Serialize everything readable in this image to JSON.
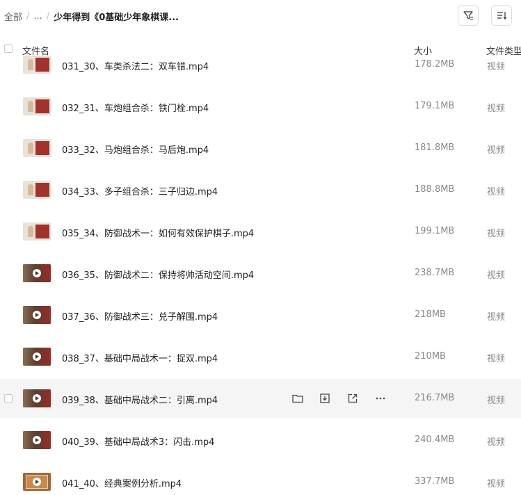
{
  "breadcrumb": {
    "root": "全部",
    "ellipsis": "...",
    "current": "少年得到《0基础少年象棋课..."
  },
  "toolbar": {
    "filter_icon": "filter-icon",
    "sort_icon": "sort-icon"
  },
  "table": {
    "headers": {
      "name": "文件名",
      "size": "大小",
      "type": "文件类型"
    },
    "rows": [
      {
        "name": "031_30、车类杀法二：双车错.mp4",
        "size": "178.2MB",
        "type": "视频",
        "thumb": "light"
      },
      {
        "name": "032_31、车炮组合杀：铁门栓.mp4",
        "size": "179.1MB",
        "type": "视频",
        "thumb": "light"
      },
      {
        "name": "033_32、马炮组合杀：马后炮.mp4",
        "size": "181.8MB",
        "type": "视频",
        "thumb": "light"
      },
      {
        "name": "034_33、多子组合杀：三子归边.mp4",
        "size": "188.8MB",
        "type": "视频",
        "thumb": "light"
      },
      {
        "name": "035_34、防御战术一：如何有效保护棋子.mp4",
        "size": "199.1MB",
        "type": "视频",
        "thumb": "light"
      },
      {
        "name": "036_35、防御战术二：保持将帅活动空间.mp4",
        "size": "238.7MB",
        "type": "视频",
        "thumb": "dark"
      },
      {
        "name": "037_36、防御战术三：兑子解围.mp4",
        "size": "218MB",
        "type": "视频",
        "thumb": "dark"
      },
      {
        "name": "038_37、基础中局战术一：捉双.mp4",
        "size": "210MB",
        "type": "视频",
        "thumb": "dark"
      },
      {
        "name": "039_38、基础中局战术二：引离.mp4",
        "size": "216.7MB",
        "type": "视频",
        "thumb": "dark",
        "hover": true
      },
      {
        "name": "040_39、基础中局战术3：闪击.mp4",
        "size": "240.4MB",
        "type": "视频",
        "thumb": "dark"
      },
      {
        "name": "041_40、经典案例分析.mp4",
        "size": "337.7MB",
        "type": "视频",
        "thumb": "orange"
      }
    ],
    "hover_actions": [
      "folder-icon",
      "download-icon",
      "share-icon",
      "more-icon"
    ]
  }
}
